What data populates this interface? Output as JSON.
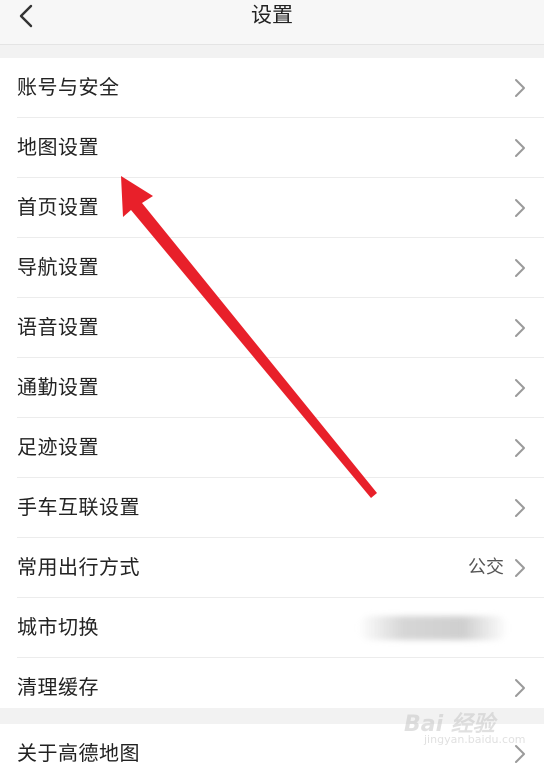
{
  "header": {
    "title": "设置",
    "back_icon": "chevron-left-icon"
  },
  "settings": [
    {
      "label": "账号与安全",
      "value": ""
    },
    {
      "label": "地图设置",
      "value": ""
    },
    {
      "label": "首页设置",
      "value": ""
    },
    {
      "label": "导航设置",
      "value": ""
    },
    {
      "label": "语音设置",
      "value": ""
    },
    {
      "label": "通勤设置",
      "value": ""
    },
    {
      "label": "足迹设置",
      "value": ""
    },
    {
      "label": "手车互联设置",
      "value": ""
    },
    {
      "label": "常用出行方式",
      "value": "公交"
    },
    {
      "label": "城市切换",
      "value": ""
    },
    {
      "label": "清理缓存",
      "value": ""
    }
  ],
  "about": {
    "label": "关于高德地图"
  },
  "annotation": {
    "arrow_color": "#e8202a"
  },
  "watermark": {
    "main": "Bai 经验",
    "sub": "jingyan.baidu.com"
  },
  "colors": {
    "background": "#f2f2f2",
    "row_background": "#ffffff",
    "chevron": "#9a9a9a"
  }
}
